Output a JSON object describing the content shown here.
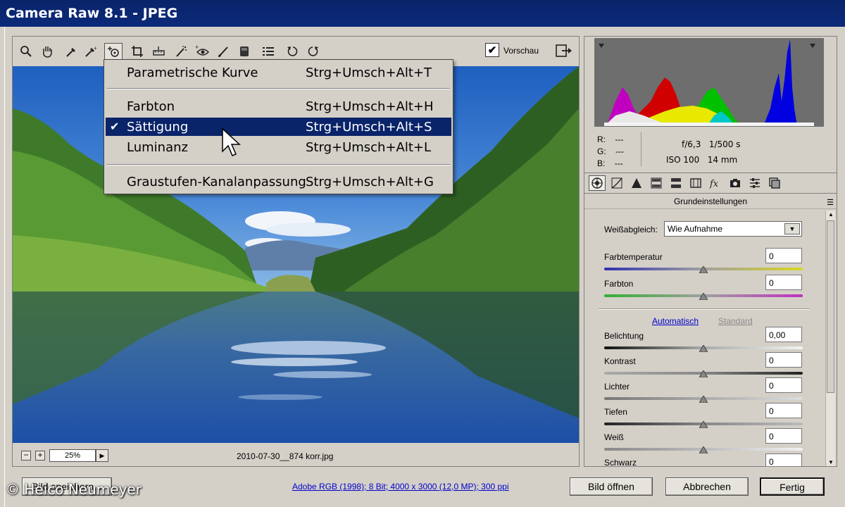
{
  "window": {
    "title": "Camera Raw 8.1 - JPEG"
  },
  "toolbar": {
    "tools": [
      "zoom-icon",
      "hand-icon",
      "white-balance-icon",
      "color-sampler-icon",
      "targeted-adjustment-icon",
      "crop-icon",
      "straighten-icon",
      "spot-removal-icon",
      "red-eye-icon",
      "adjustment-brush-icon",
      "graduated-filter-icon",
      "preferences-icon",
      "rotate-left-icon",
      "rotate-right-icon"
    ],
    "preview_label": "Vorschau",
    "preview_checked": "✔"
  },
  "menu": {
    "items": [
      {
        "label": "Parametrische Kurve",
        "shortcut": "Strg+Umsch+Alt+T",
        "checked": ""
      },
      {
        "label": "Farbton",
        "shortcut": "Strg+Umsch+Alt+H",
        "checked": ""
      },
      {
        "label": "Sättigung",
        "shortcut": "Strg+Umsch+Alt+S",
        "checked": "✔"
      },
      {
        "label": "Luminanz",
        "shortcut": "Strg+Umsch+Alt+L",
        "checked": ""
      },
      {
        "label": "Graustufen-Kanalanpassung",
        "shortcut": "Strg+Umsch+Alt+G",
        "checked": ""
      }
    ]
  },
  "statusbar": {
    "zoom_out": "−",
    "zoom_in": "+",
    "zoom_value": "25%",
    "zoom_arrow": "▶",
    "filename": "2010-07-30__874 korr.jpg"
  },
  "info": {
    "r_label": "R:",
    "r_value": "---",
    "g_label": "G:",
    "g_value": "---",
    "b_label": "B:",
    "b_value": "---",
    "aperture": "f/6,3",
    "shutter": "1/500 s",
    "iso": "ISO 100",
    "focal": "14 mm"
  },
  "panel": {
    "title": "Grundeinstellungen",
    "menu_glyph": "☰",
    "white_balance_label": "Weißabgleich:",
    "white_balance_value": "Wie Aufnahme",
    "auto_link": "Automatisch",
    "default_link": "Standard",
    "sliders": [
      {
        "label": "Farbtemperatur",
        "value": "0"
      },
      {
        "label": "Farbton",
        "value": "0"
      },
      {
        "label": "Belichtung",
        "value": "0,00"
      },
      {
        "label": "Kontrast",
        "value": "0"
      },
      {
        "label": "Lichter",
        "value": "0"
      },
      {
        "label": "Tiefen",
        "value": "0"
      },
      {
        "label": "Weiß",
        "value": "0"
      },
      {
        "label": "Schwarz",
        "value": "0"
      }
    ]
  },
  "footer": {
    "save_button": "Bild speichern...",
    "color_info": "Adobe RGB (1998); 8 Bit; 4000 x 3000 (12,0 MP); 300 ppi",
    "open_button": "Bild öffnen",
    "cancel_button": "Abbrechen",
    "done_button": "Fertig"
  },
  "watermark": "© Heico Neumeyer",
  "colors": {
    "title_bar": "#0a246a",
    "menu_highlight": "#0a246a",
    "link": "#0000cc"
  }
}
